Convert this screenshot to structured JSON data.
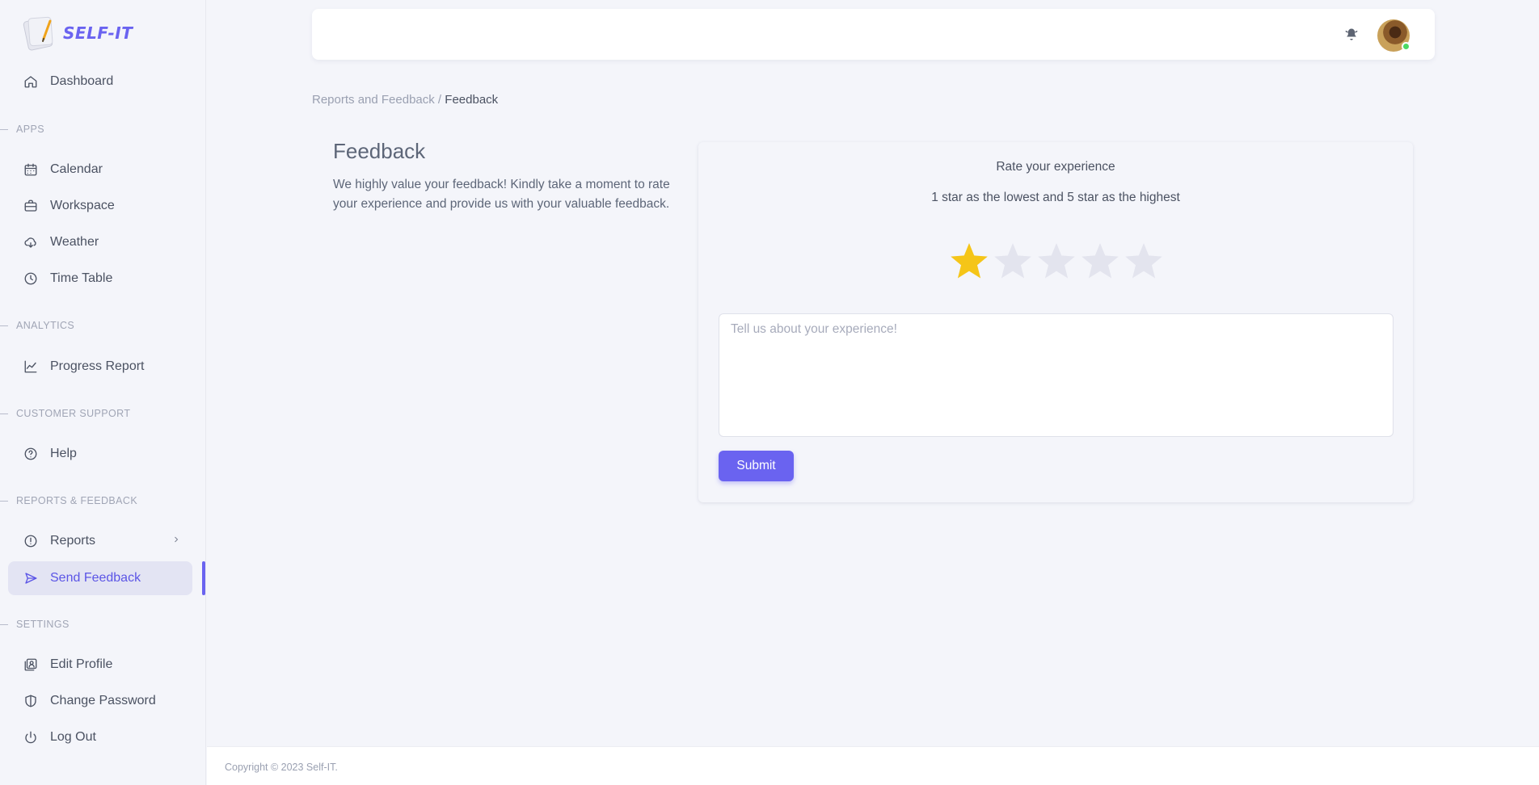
{
  "brand": {
    "name": "SELF-IT"
  },
  "colors": {
    "accent": "#6a63f0",
    "star_filled": "#f5c518",
    "star_empty": "#e3e4ee",
    "online": "#4cd964"
  },
  "sidebar": {
    "dashboard": {
      "label": "Dashboard",
      "icon": "home-icon"
    },
    "sections": {
      "apps": "APPS",
      "analytics": "ANALYTICS",
      "support": "CUSTOMER SUPPORT",
      "reports": "REPORTS & FEEDBACK",
      "settings": "SETTINGS"
    },
    "apps": [
      {
        "label": "Calendar",
        "icon": "calendar-icon"
      },
      {
        "label": "Workspace",
        "icon": "briefcase-icon"
      },
      {
        "label": "Weather",
        "icon": "cloud-icon"
      },
      {
        "label": "Time Table",
        "icon": "clock-icon"
      }
    ],
    "analytics": [
      {
        "label": "Progress Report",
        "icon": "chart-line-icon"
      }
    ],
    "support": [
      {
        "label": "Help",
        "icon": "help-circle-icon"
      }
    ],
    "reports": [
      {
        "label": "Reports",
        "icon": "alert-circle-icon"
      },
      {
        "label": "Send Feedback",
        "icon": "send-icon",
        "active": true
      }
    ],
    "settings": [
      {
        "label": "Edit Profile",
        "icon": "profile-icon"
      },
      {
        "label": "Change Password",
        "icon": "shield-icon"
      },
      {
        "label": "Log Out",
        "icon": "power-icon"
      }
    ]
  },
  "breadcrumb": {
    "parent": "Reports and Feedback",
    "separator": " / ",
    "current": "Feedback"
  },
  "intro": {
    "title": "Feedback",
    "description": "We highly value your feedback! Kindly take a moment to rate your experience and provide us with your valuable feedback."
  },
  "rating": {
    "title": "Rate your experience",
    "subtitle": "1 star as the lowest and 5 star as the highest",
    "value": 1,
    "max": 5
  },
  "form": {
    "placeholder": "Tell us about your experience!",
    "value": "",
    "submit_label": "Submit"
  },
  "footer": {
    "text": "Copyright © 2023 Self-IT."
  }
}
